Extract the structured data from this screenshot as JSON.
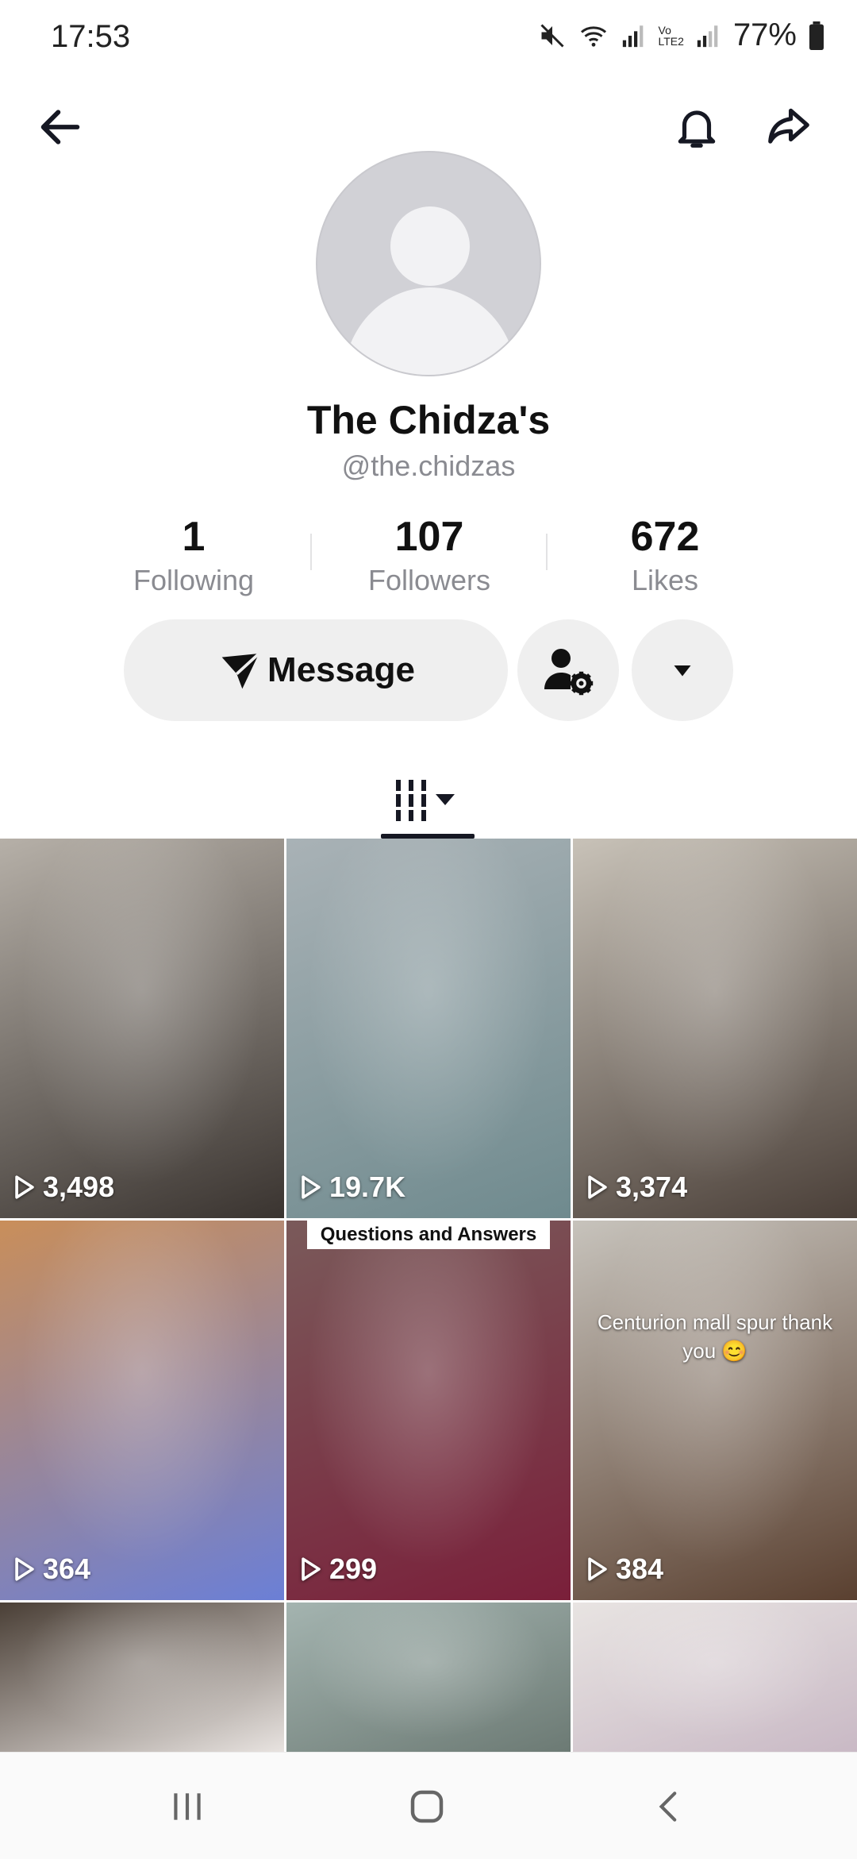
{
  "status": {
    "time": "17:53",
    "battery": "77%",
    "network_label_top": "Vo",
    "network_label_bottom": "LTE2"
  },
  "header": {
    "back_icon": "arrow-left-icon",
    "bell_icon": "bell-icon",
    "share_icon": "share-arrow-icon"
  },
  "profile": {
    "name": "The Chidza's",
    "handle": "@the.chidzas"
  },
  "stats": {
    "following": {
      "value": "1",
      "label": "Following"
    },
    "followers": {
      "value": "107",
      "label": "Followers"
    },
    "likes": {
      "value": "672",
      "label": "Likes"
    }
  },
  "actions": {
    "message_label": "Message"
  },
  "videos": [
    {
      "views": "3,498",
      "colors": [
        "#b6b0a8",
        "#3a3430"
      ]
    },
    {
      "views": "19.7K",
      "colors": [
        "#a9b2b6",
        "#6f8a8e"
      ]
    },
    {
      "views": "3,374",
      "colors": [
        "#c8c2b8",
        "#4a3f38"
      ]
    },
    {
      "views": "364",
      "colors": [
        "#c98e5a",
        "#6b7fd6"
      ]
    },
    {
      "views": "299",
      "caption": "Questions and Answers",
      "colors": [
        "#7a5a5a",
        "#7a1f3a"
      ]
    },
    {
      "views": "384",
      "caption": "Centurion mall spur thank you 😊",
      "colors": [
        "#c7c3bc",
        "#5a4030"
      ]
    },
    {
      "colors": [
        "#4a3f36",
        "#e8e3e0"
      ]
    },
    {
      "colors": [
        "#a4b4b0",
        "#6c7a74"
      ]
    },
    {
      "colors": [
        "#e8e4e2",
        "#c9b9c5"
      ]
    }
  ],
  "nav": {
    "recent_icon": "recent-apps-icon",
    "home_icon": "home-icon",
    "back_icon": "nav-back-icon"
  }
}
